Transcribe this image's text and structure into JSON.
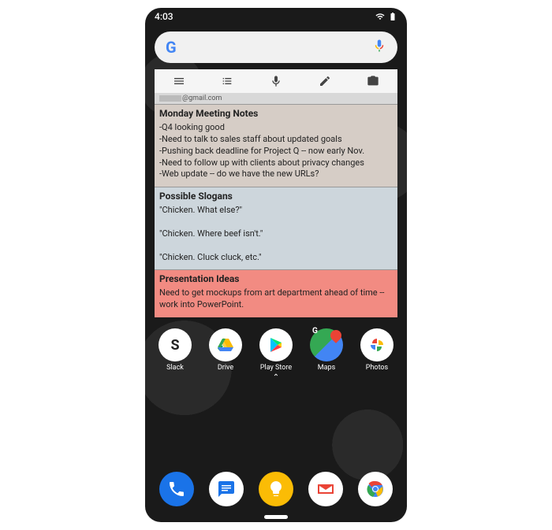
{
  "statusbar": {
    "time": "4:03"
  },
  "widget": {
    "account_suffix": "@gmail.com",
    "notes": [
      {
        "title": "Monday Meeting Notes",
        "body": "-Q4 looking good\n-Need to talk to sales staff about updated goals\n-Pushing back deadline for Project Q -- now early Nov.\n-Need to follow up with clients about privacy changes\n-Web update -- do we have the new URLs?"
      },
      {
        "title": "Possible Slogans",
        "body": "\"Chicken. What else?\"\n\n\"Chicken. Where beef isn't.\"\n\n\"Chicken. Cluck cluck, etc.\""
      },
      {
        "title": "Presentation Ideas",
        "body": "Need to get mockups from art department ahead of time -- work into PowerPoint."
      }
    ]
  },
  "apps": [
    {
      "label": "Slack"
    },
    {
      "label": "Drive"
    },
    {
      "label": "Play Store"
    },
    {
      "label": "Maps"
    },
    {
      "label": "Photos"
    }
  ]
}
